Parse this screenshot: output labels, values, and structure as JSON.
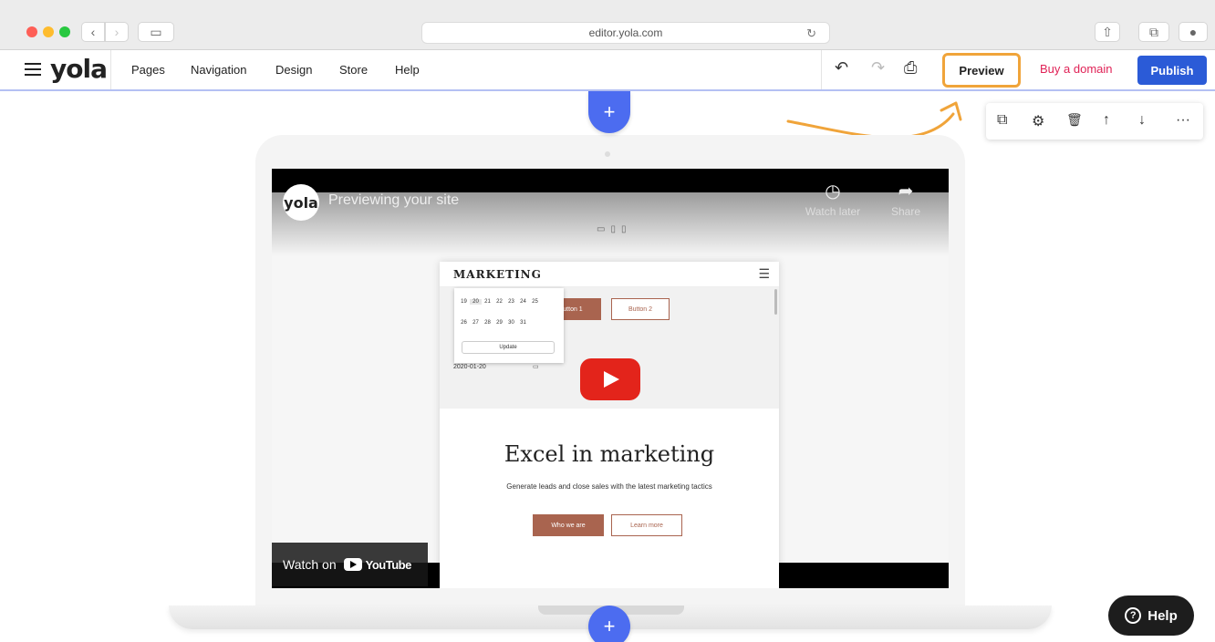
{
  "browser": {
    "url": "editor.yola.com",
    "back_icon": "‹",
    "forward_icon": "›",
    "sidebar_icon": "▭",
    "reload_icon": "↻",
    "share_icon": "⇧",
    "tabs_icon": "⧉",
    "download_icon": "●"
  },
  "header": {
    "logo": "yola",
    "menu": [
      "Pages",
      "Navigation",
      "Design",
      "Store",
      "Help"
    ],
    "undo_icon": "↶",
    "redo_icon": "↷",
    "save_icon": "⎙",
    "preview_label": "Preview",
    "buy_domain_label": "Buy a domain",
    "publish_label": "Publish",
    "colors": {
      "publish": "#2b5bd7",
      "buy_domain": "#e02256",
      "highlight": "#f0a43a"
    }
  },
  "canvas": {
    "add_section_icon": "+",
    "block_toolbar": {
      "duplicate_icon": "⧉",
      "settings_icon": "⚙",
      "delete_icon": "🗑",
      "move_up_icon": "↑",
      "move_down_icon": "↓",
      "more_icon": "···"
    }
  },
  "video": {
    "channel_logo": "yola",
    "title": "Previewing your site",
    "watch_later_label": "Watch later",
    "share_label": "Share",
    "watch_on_label": "Watch on",
    "youtube_label": "YouTube",
    "preview_site": {
      "site_title": "MARKETING",
      "button1": "utton 1",
      "button2": "Button 2",
      "calendar_row1": [
        "19",
        "20",
        "21",
        "22",
        "23",
        "24",
        "25"
      ],
      "calendar_row2": [
        "26",
        "27",
        "28",
        "29",
        "30",
        "31"
      ],
      "update_label": "Update",
      "date_value": "2020-01-20",
      "hero_title": "Excel in marketing",
      "hero_subtitle": "Generate leads and close sales with the latest marketing tactics",
      "cta_primary": "Who we are",
      "cta_secondary": "Learn more"
    }
  },
  "help_button": {
    "label": "Help",
    "icon": "?"
  }
}
